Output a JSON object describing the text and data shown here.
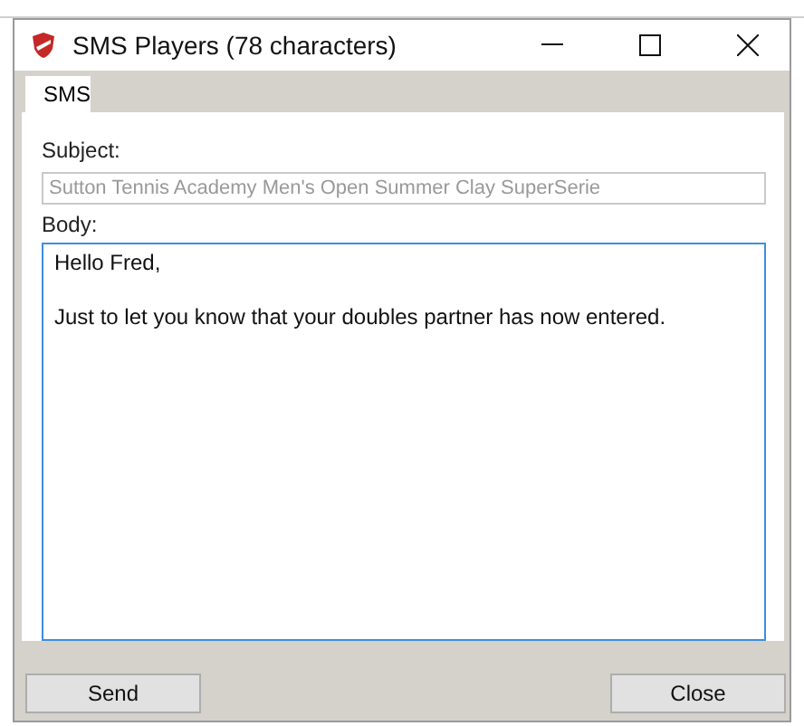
{
  "window": {
    "title": "SMS Players (78 characters)"
  },
  "tabs": [
    {
      "label": "SMS",
      "selected": true
    }
  ],
  "subject": {
    "label": "Subject:",
    "value": "Sutton Tennis Academy Men's Open Summer Clay SuperSerie",
    "disabled": true
  },
  "body": {
    "label": "Body:",
    "value": "Hello Fred,\n\nJust to let you know that your doubles partner has now entered."
  },
  "buttons": [
    "Send",
    "Close"
  ]
}
